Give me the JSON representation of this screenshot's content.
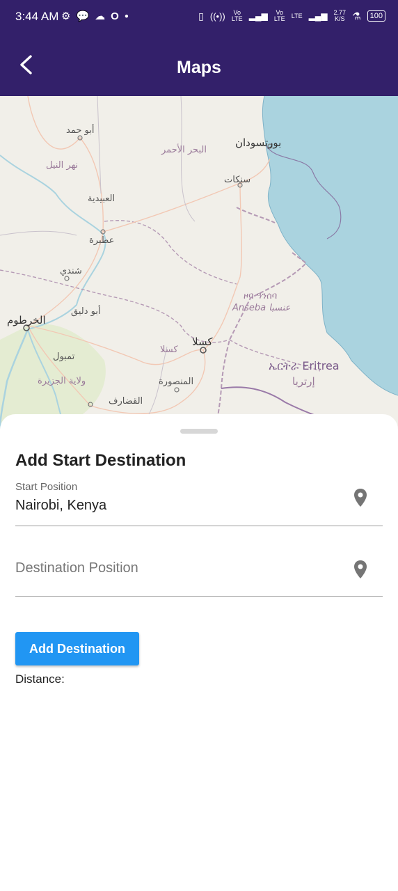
{
  "status_bar": {
    "time": "3:44 AM",
    "icons_left": [
      "gear-icon",
      "chat-icon",
      "cloud-icon",
      "opera-icon",
      "dot-icon"
    ],
    "net_speed_top": "2.77",
    "net_speed_bottom": "K/S",
    "volte_1": "Vo LTE",
    "volte_2": "Vo LTE",
    "lte": "LTE",
    "battery": "100"
  },
  "app_bar": {
    "title": "Maps"
  },
  "map": {
    "labels": {
      "abu_hamad": "أبو حمد",
      "red_sea": "البحر الأحمر",
      "port_sudan": "بورتسودان",
      "river_nile": "نهر النيل",
      "sinkat": "سنكات",
      "al_ubaydiyah": "العبيدية",
      "atbara": "عطبرة",
      "shendi": "شندي",
      "anseba_tigrinya": "ዞባ ዓንሰባ",
      "anseba": "Anseba عنسبا",
      "khartoum": "الخرطوم",
      "abu_deleig": "أبو دليق",
      "kassala_big": "كسلا",
      "kassala_small": "كسلا",
      "eritrea": "ኤርትራ Eritrea",
      "eritrea_ar": "إرتريا",
      "tamboul": "تمبول",
      "gezira": "ولاية الجزيرة",
      "mansoura": "المنصورة",
      "gedaref": "القضارف"
    }
  },
  "sheet": {
    "heading": "Add Start Destination",
    "start_field": {
      "label": "Start Position",
      "value": "Nairobi, Kenya"
    },
    "destination_field": {
      "placeholder": "Destination Position"
    },
    "add_button": "Add Destination",
    "distance_label": "Distance:"
  },
  "colors": {
    "app_bar": "#33206a",
    "button": "#2196f3",
    "sea": "#aad3df",
    "land": "#f1efe9"
  }
}
